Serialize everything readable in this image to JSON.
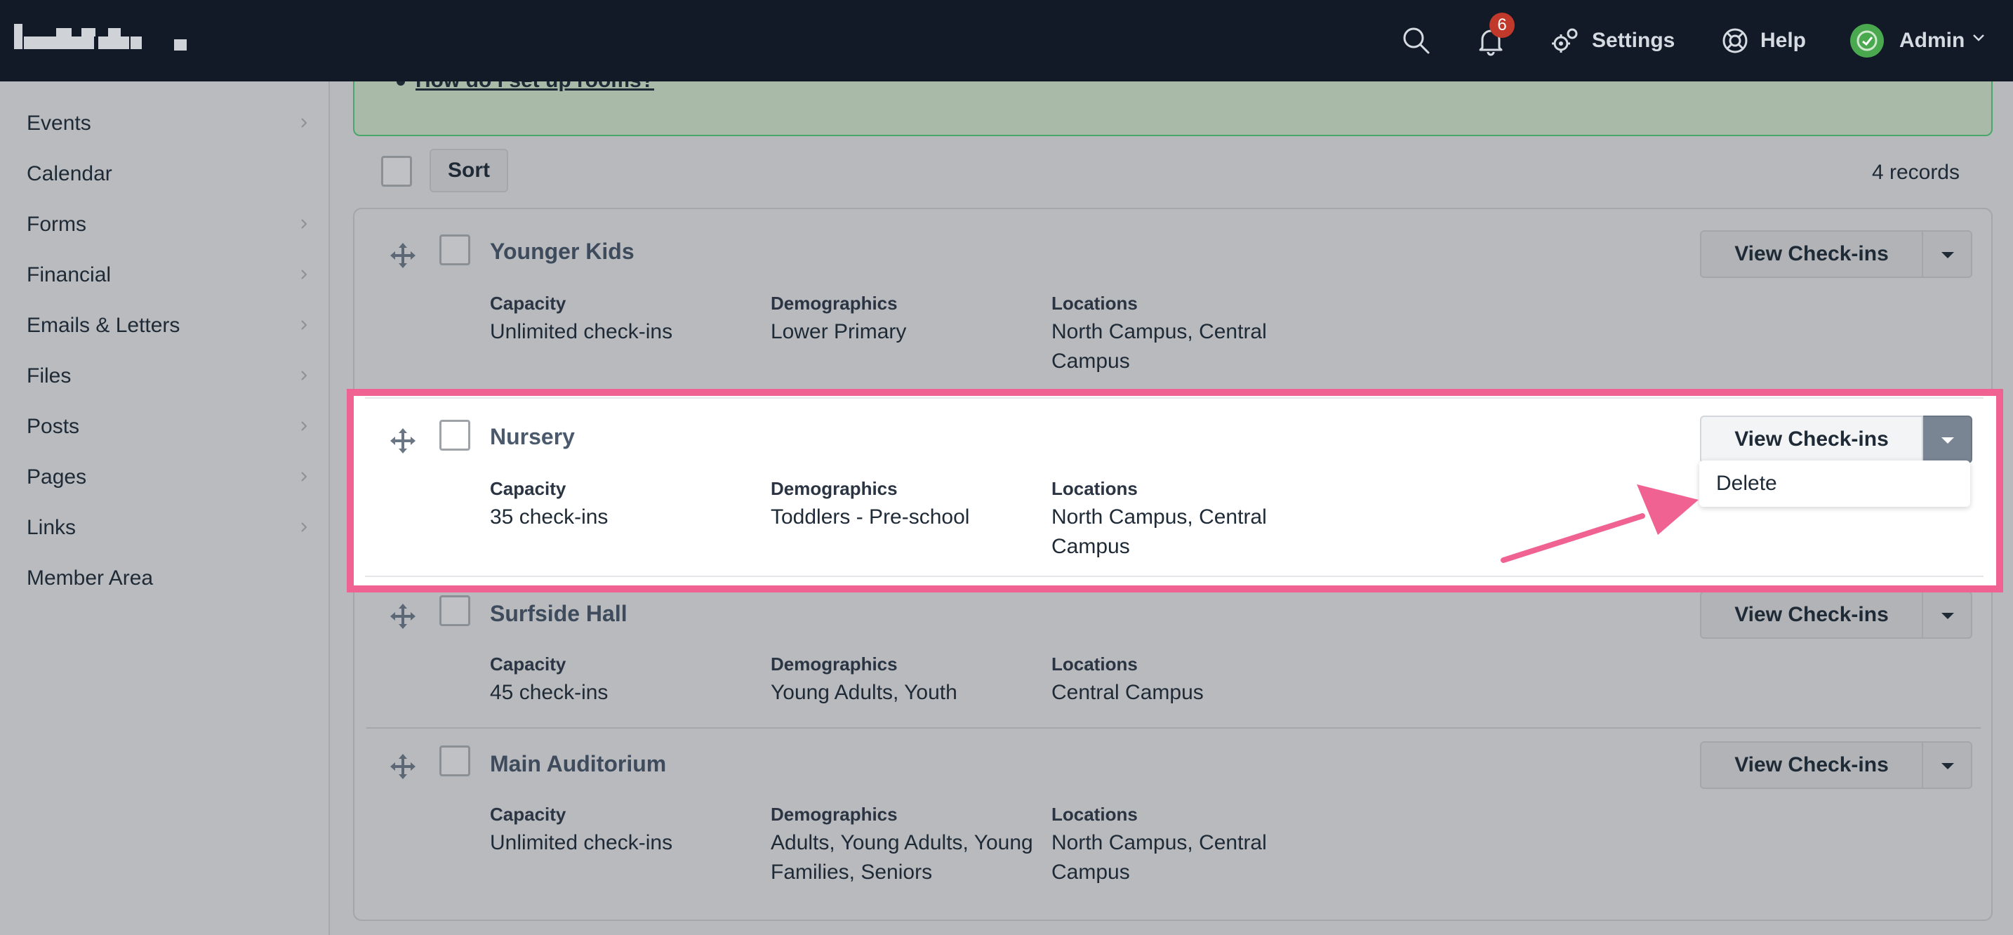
{
  "topbar": {
    "notifications_count": "6",
    "settings_label": "Settings",
    "help_label": "Help",
    "user_label": "Admin"
  },
  "sidebar": {
    "items": [
      {
        "label": "Events",
        "has_submenu": true
      },
      {
        "label": "Calendar",
        "has_submenu": false
      },
      {
        "label": "Forms",
        "has_submenu": true
      },
      {
        "label": "Financial",
        "has_submenu": true
      },
      {
        "label": "Emails & Letters",
        "has_submenu": true
      },
      {
        "label": "Files",
        "has_submenu": true
      },
      {
        "label": "Posts",
        "has_submenu": true
      },
      {
        "label": "Pages",
        "has_submenu": true
      },
      {
        "label": "Links",
        "has_submenu": true
      },
      {
        "label": "Member Area",
        "has_submenu": false
      }
    ]
  },
  "help": {
    "link_text": "How do I set up rooms?"
  },
  "toolbar": {
    "sort_label": "Sort",
    "records_text": "4 records"
  },
  "labels": {
    "capacity": "Capacity",
    "demographics": "Demographics",
    "locations": "Locations",
    "view_checkins": "View Check-ins"
  },
  "rooms": [
    {
      "name": "Younger Kids",
      "capacity": "Unlimited check-ins",
      "demographics": "Lower Primary",
      "locations": "North Campus, Central Campus"
    },
    {
      "name": "Nursery",
      "capacity": "35 check-ins",
      "demographics": "Toddlers - Pre-school",
      "locations": "North Campus, Central Campus"
    },
    {
      "name": "Surfside Hall",
      "capacity": "45 check-ins",
      "demographics": "Young Adults, Youth",
      "locations": "Central Campus"
    },
    {
      "name": "Main Auditorium",
      "capacity": "Unlimited check-ins",
      "demographics": "Adults, Young Adults, Young Families, Seniors",
      "locations": "North Campus, Central Campus"
    }
  ],
  "dropdown": {
    "items": [
      "Delete"
    ]
  },
  "colors": {
    "topbar_bg": "#121a27",
    "highlight": "#f06292",
    "help_border": "#4aa66a",
    "badge": "#c0392b",
    "avatar": "#4aa84f"
  },
  "icons": {
    "search": "search-icon",
    "notifications": "bell-icon",
    "settings": "gear-icon",
    "help": "lifebuoy-icon",
    "user_menu": "chevron-down-icon",
    "drag": "move-icon",
    "submenu": "chevron-right-icon"
  }
}
